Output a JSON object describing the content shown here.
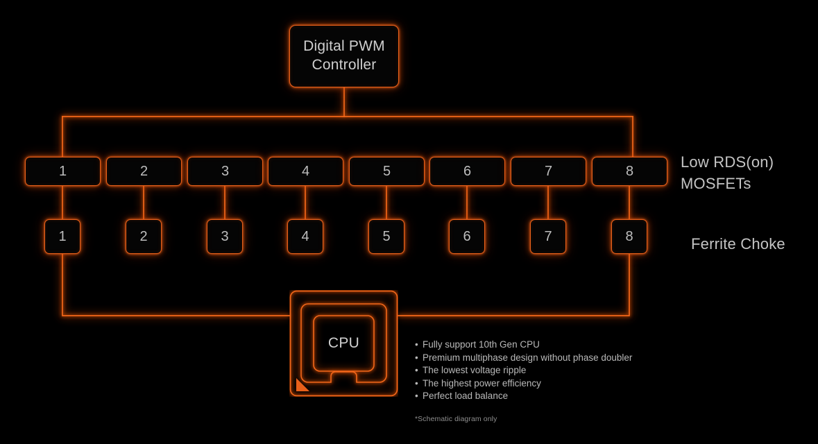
{
  "diagram": {
    "title_block": {
      "line1": "Digital PWM",
      "line2": "Controller"
    },
    "cpu_label": "CPU",
    "mosfet_row": {
      "label_line1": "Low RDS(on)",
      "label_line2": "MOSFETs",
      "items": [
        "1",
        "2",
        "3",
        "4",
        "5",
        "6",
        "7",
        "8"
      ]
    },
    "choke_row": {
      "label": "Ferrite Choke",
      "items": [
        "1",
        "2",
        "3",
        "4",
        "5",
        "6",
        "7",
        "8"
      ]
    },
    "features": [
      "Fully support 10th Gen CPU",
      "Premium multiphase design without phase doubler",
      "The lowest voltage ripple",
      "The highest power efficiency",
      "Perfect load balance"
    ],
    "footnote": "*Schematic diagram only",
    "colors": {
      "background": "#000000",
      "trace": "#e8601a",
      "glow": "#ff6a14",
      "text": "#c4c4c4",
      "box_fill": "#050505"
    }
  }
}
